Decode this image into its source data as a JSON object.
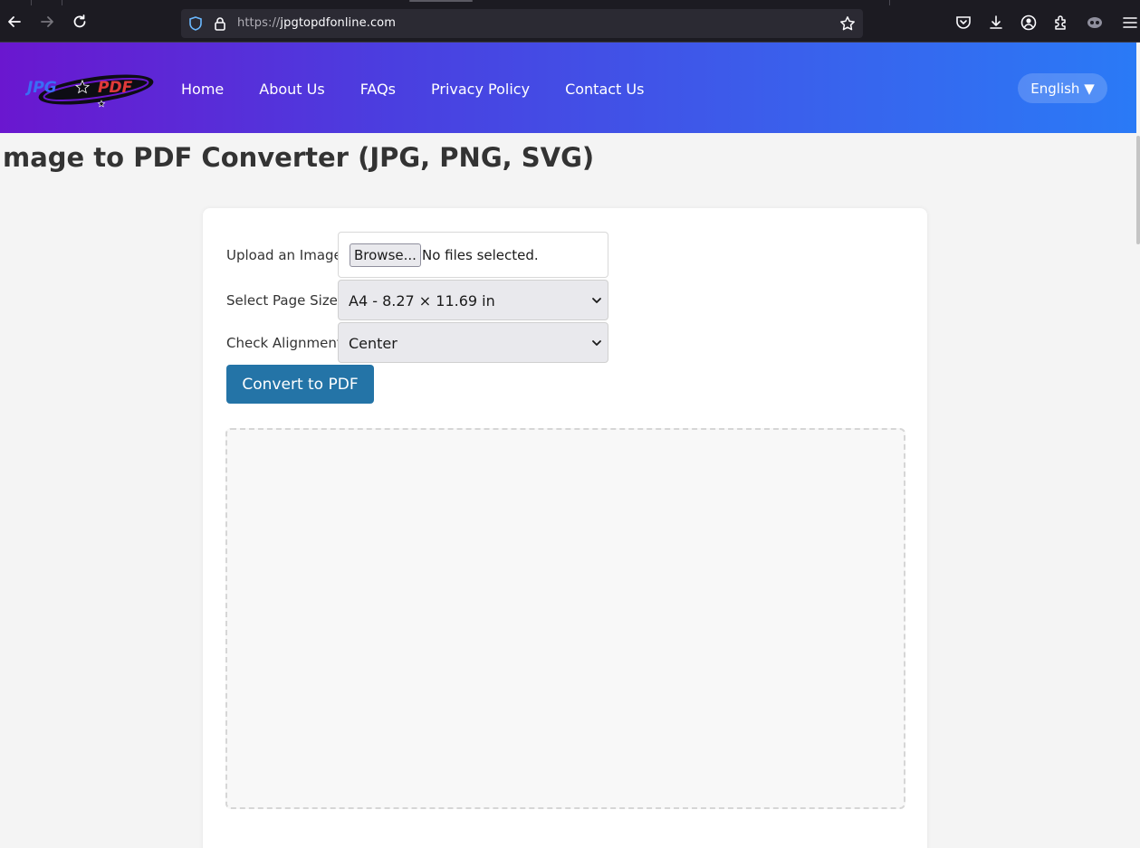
{
  "browser": {
    "url_proto": "https://",
    "url_host": "jpgtopdfonline.com"
  },
  "header": {
    "logo_text_left": "JPG",
    "logo_text_right": "PDF",
    "nav": [
      "Home",
      "About Us",
      "FAQs",
      "Privacy Policy",
      "Contact Us"
    ],
    "language": "English ▼"
  },
  "main": {
    "title": "mage to PDF Converter (JPG, PNG, SVG)",
    "upload_label": "Upload an Image:",
    "browse_label": "Browse...",
    "file_status": "No files selected.",
    "page_size_label": "Select Page Size:",
    "page_size_value": "A4 - 8.27 × 11.69 in",
    "alignment_label": "Check Alignment:",
    "alignment_value": "Center",
    "convert_label": "Convert to PDF"
  },
  "colors": {
    "header_gradient_start": "#6a17cf",
    "header_gradient_end": "#2a7af6",
    "convert_button": "#2474a7"
  }
}
